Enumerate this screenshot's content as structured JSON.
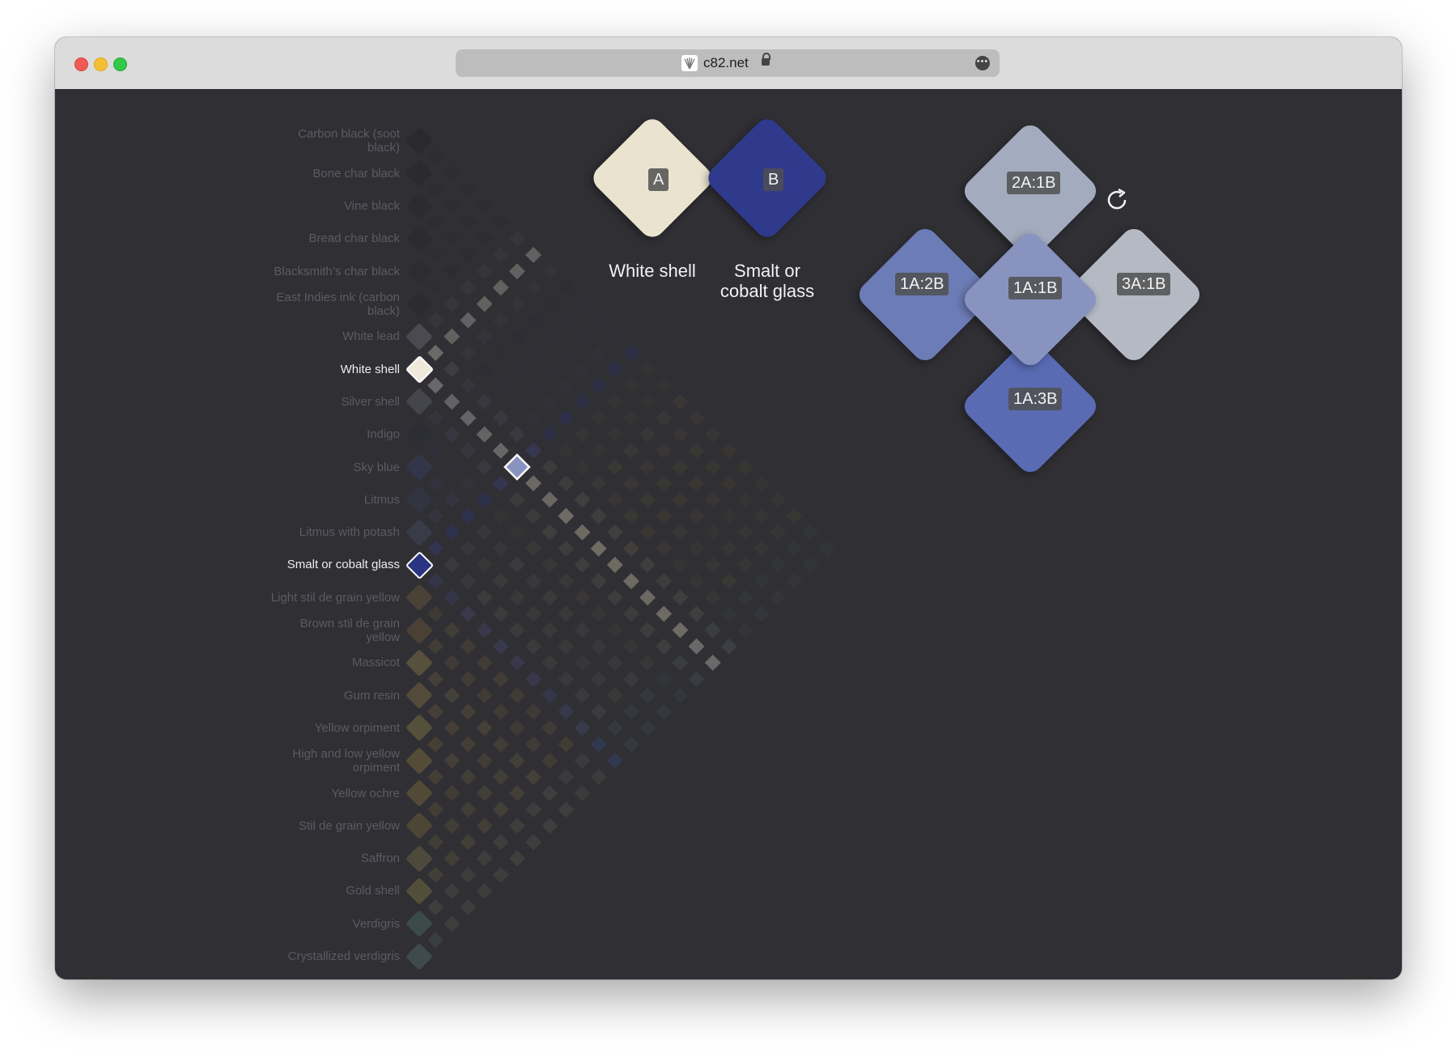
{
  "browser": {
    "url": "c82.net"
  },
  "pigments": [
    {
      "name": "Carbon black (soot black)",
      "color": "#2a2a2d"
    },
    {
      "name": "Bone char black",
      "color": "#2b2b2e"
    },
    {
      "name": "Vine black",
      "color": "#2c2c30"
    },
    {
      "name": "Bread char black",
      "color": "#2c2c30"
    },
    {
      "name": "Blacksmith’s char black",
      "color": "#2d2d31"
    },
    {
      "name": "East Indies ink (carbon black)",
      "color": "#2c2c30"
    },
    {
      "name": "White lead",
      "color": "#4a4a50"
    },
    {
      "name": "White shell",
      "color": "#efe9da",
      "active": true
    },
    {
      "name": "Silver shell",
      "color": "#45464c"
    },
    {
      "name": "Indigo",
      "color": "#2c2d35"
    },
    {
      "name": "Sky blue",
      "color": "#333648"
    },
    {
      "name": "Litmus",
      "color": "#333441"
    },
    {
      "name": "Litmus with potash",
      "color": "#393c48"
    },
    {
      "name": "Smalt or cobalt glass",
      "color": "#2b3480",
      "active": true
    },
    {
      "name": "Light stil de grain yellow",
      "color": "#4a4236"
    },
    {
      "name": "Brown stil de grain yellow",
      "color": "#4a4035"
    },
    {
      "name": "Massicot",
      "color": "#57503d"
    },
    {
      "name": "Gum resin",
      "color": "#544a3a"
    },
    {
      "name": "Yellow orpiment",
      "color": "#55503a"
    },
    {
      "name": "High and low yellow orpiment",
      "color": "#554c38"
    },
    {
      "name": "Yellow ochre",
      "color": "#524a37"
    },
    {
      "name": "Stil de grain yellow",
      "color": "#4d4636"
    },
    {
      "name": "Saffron",
      "color": "#4d4a3c"
    },
    {
      "name": "Gold shell",
      "color": "#524e39"
    },
    {
      "name": "Verdigris",
      "color": "#3c4a4a"
    },
    {
      "name": "Crystallized verdigris",
      "color": "#3f4a4c"
    }
  ],
  "mixer": {
    "a": {
      "tag": "A",
      "name": "White shell",
      "color": "#eae3cf"
    },
    "b": {
      "tag": "B",
      "name": "Smalt or cobalt glass",
      "color": "#2f3a8c"
    },
    "mixes": [
      {
        "tag": "2A:1B",
        "color": "#a3abbf"
      },
      {
        "tag": "1A:2B",
        "color": "#6c7cb6"
      },
      {
        "tag": "1A:1B",
        "color": "#8893c0"
      },
      {
        "tag": "3A:1B",
        "color": "#b4b9c4"
      },
      {
        "tag": "1A:3B",
        "color": "#5a6bb4"
      }
    ],
    "refresh_icon": "refresh-icon"
  }
}
